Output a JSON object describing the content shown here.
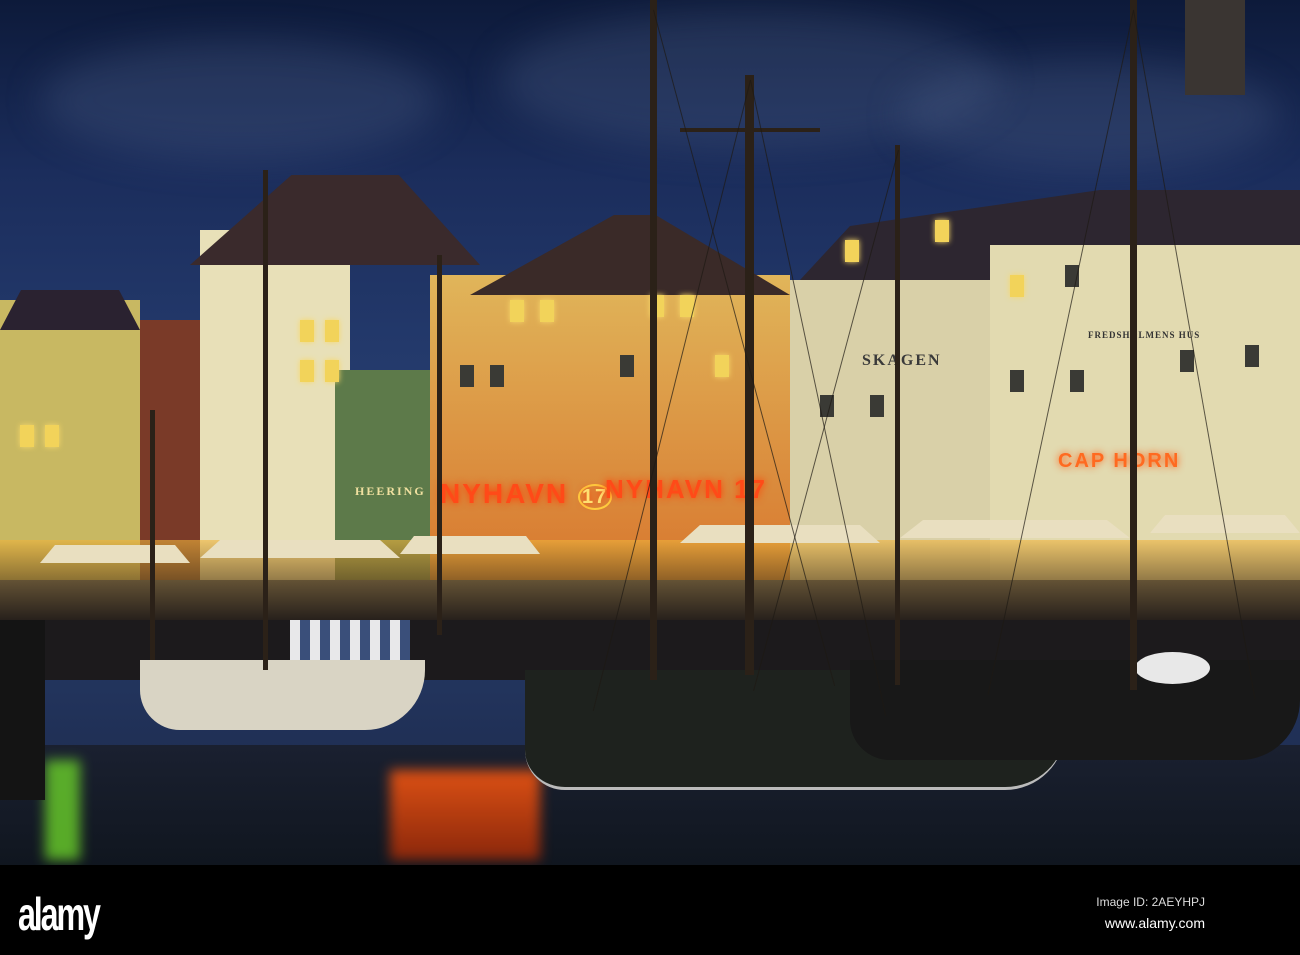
{
  "signs": {
    "nyhavn_left": "NYHAVN",
    "nyhavn_left_num": "17",
    "nyhavn_right": "NYHAVN",
    "nyhavn_right_num": "17",
    "heering": "HEERING",
    "skagen": "SKAGEN",
    "fredsholm": "FREDSHOLMENS HUS",
    "caphorn": "CAP HORN"
  },
  "watermark": {
    "logo": "alamy",
    "image_id": "Image ID: 2AEYHPJ",
    "url": "www.alamy.com"
  },
  "colors": {
    "sky": "#1b2d5c",
    "neon": "#ff5a1a",
    "window": "#f2d35a"
  }
}
